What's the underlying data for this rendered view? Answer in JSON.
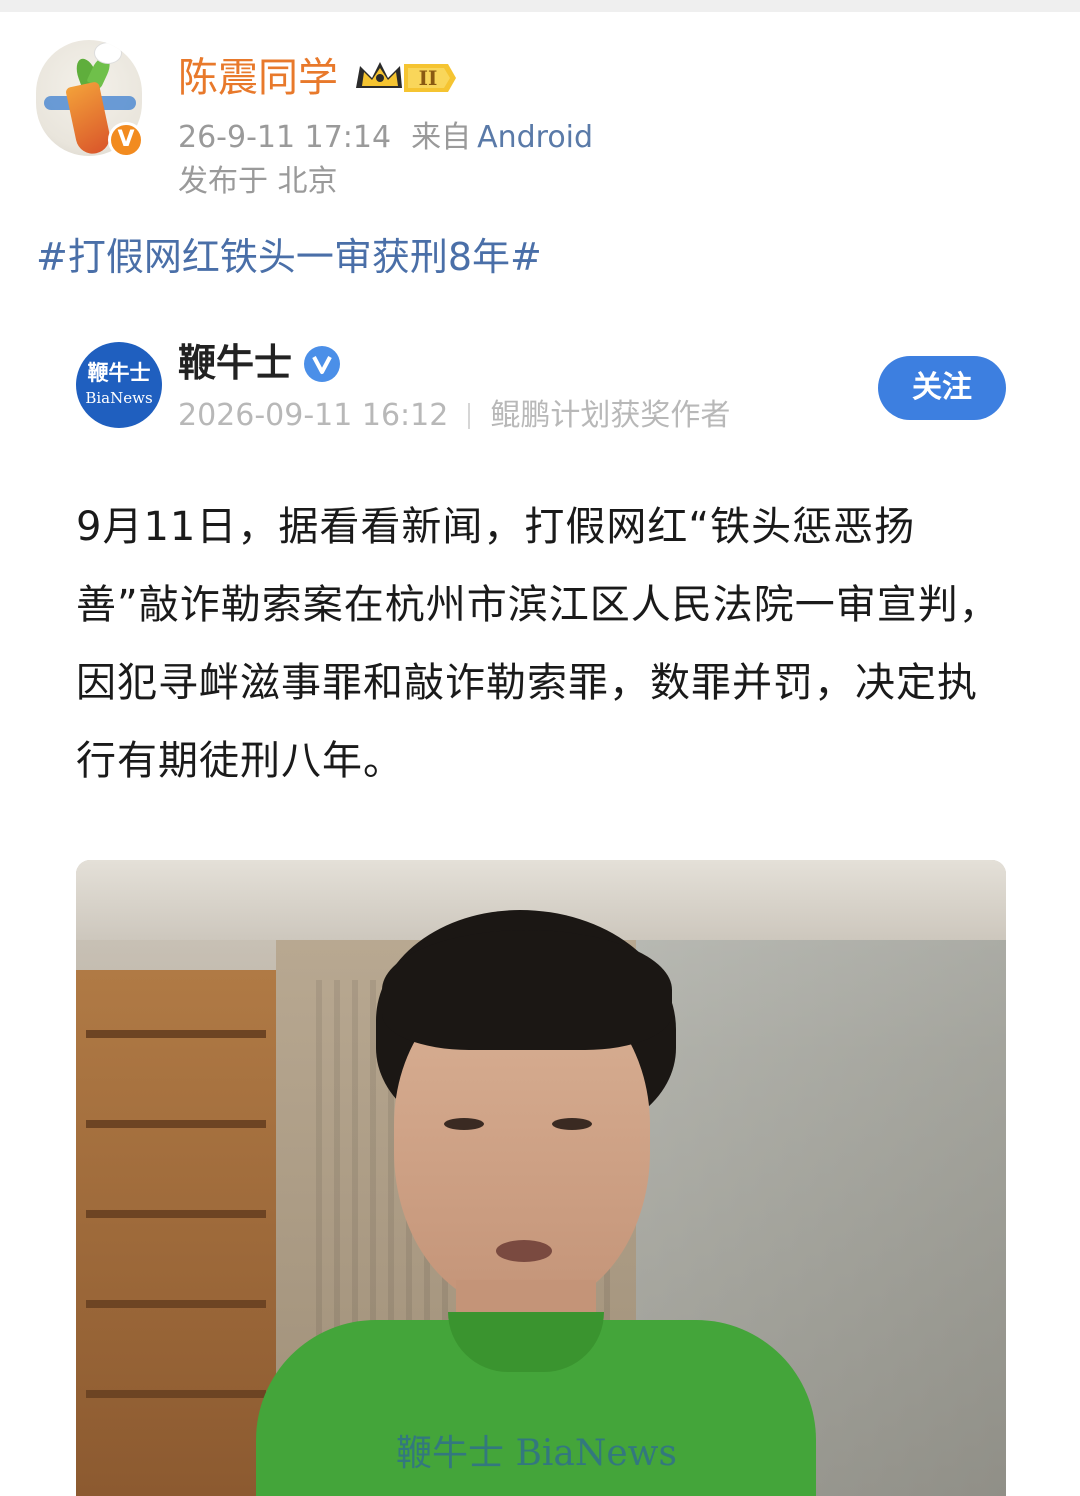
{
  "post": {
    "username": "陈震同学",
    "level_badge": "II",
    "time": "26-9-11 17:14",
    "source_prefix": "来自",
    "device": "Android",
    "location": "发布于 北京",
    "hashtag": "#打假网红铁头一审获刑8年#"
  },
  "card": {
    "logo_line1": "鞭牛士",
    "logo_line2": "BiaNews",
    "name": "鞭牛士",
    "time": "2026-09-11 16:12",
    "award": "鲲鹏计划获奖作者",
    "follow_label": "关注",
    "body": "9月11日，据看看新闻，打假网红“铁头惩恶扬善”敲诈勒索案在杭州市滨江区人民法院一审宣判，因犯寻衅滋事罪和敲诈勒索罪，数罪并罚，决定执行有期徒刑八年。",
    "photo_watermark": "鞭牛士 BiaNews"
  },
  "colors": {
    "username": "#e8792b",
    "hashtag": "#4a6fa8",
    "follow_button": "#3d7fe0",
    "verify_badge": "#f28b1f"
  },
  "icons": {
    "avatar": "carrot-avatar-icon",
    "verified": "orange-v-verified-icon",
    "level": "crown-level-icon",
    "card_verified": "blue-v-verified-icon"
  }
}
